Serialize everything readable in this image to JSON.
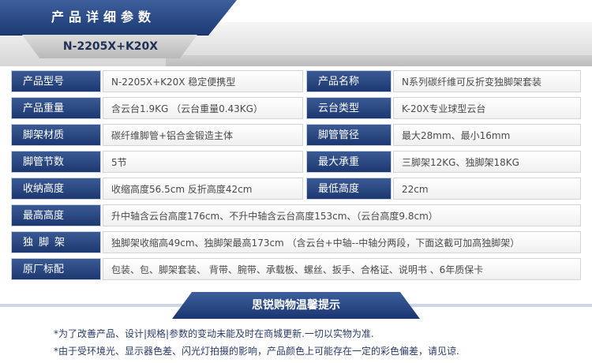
{
  "header": {
    "title": "产品详细参数",
    "model": "N-2205X+K20X"
  },
  "specs": [
    {
      "label": "产品型号",
      "value": "N-2205X+K20X  稳定便携型",
      "label2": "产品名称",
      "value2": "N系列碳纤维可反折变独脚架套装"
    },
    {
      "label": "产品重量",
      "value": "含云台1.9KG （云台重量0.43KG）",
      "label2": "云台类型",
      "value2": "K-20X专业球型云台"
    },
    {
      "label": "脚架材质",
      "value": "碳纤维脚管+铝合金锻造主体",
      "label2": "脚管管径",
      "value2": "最大28mm、最小16mm"
    },
    {
      "label": "脚管节数",
      "value": "5节",
      "label2": "最大承重",
      "value2": "三脚架12KG、独脚架18KG"
    },
    {
      "label": "收纳高度",
      "value": "收缩高度56.5cm  反折高度42cm",
      "label2": "最低高度",
      "value2": "22cm"
    },
    {
      "label": "最高高度",
      "value": "升中轴含云台高度176cm、不升中轴含云台高度153cm、（云台高度9.8cm）"
    },
    {
      "label": "独脚架",
      "value": "独脚架收缩高49cm、独脚架最高173cm （含云台+中轴--中轴分两段，下面这截可加高独脚架）"
    },
    {
      "label": "原厂标配",
      "value": "包装、包、脚架套装、 背带、腕带、承载板、螺丝、扳手、合格证、说明书 、6年质保卡"
    }
  ],
  "footer": {
    "title": "思锐购物温馨提示",
    "notes": [
      "*为了改善产品、设计|规格|参数的变动未能及时在商城更新.一切以实物为准.",
      "*由于受环境光、显示器色差、闪光灯拍摄的影响，产品颜色上可能存在一定的彩色偏差，请见谅."
    ]
  }
}
